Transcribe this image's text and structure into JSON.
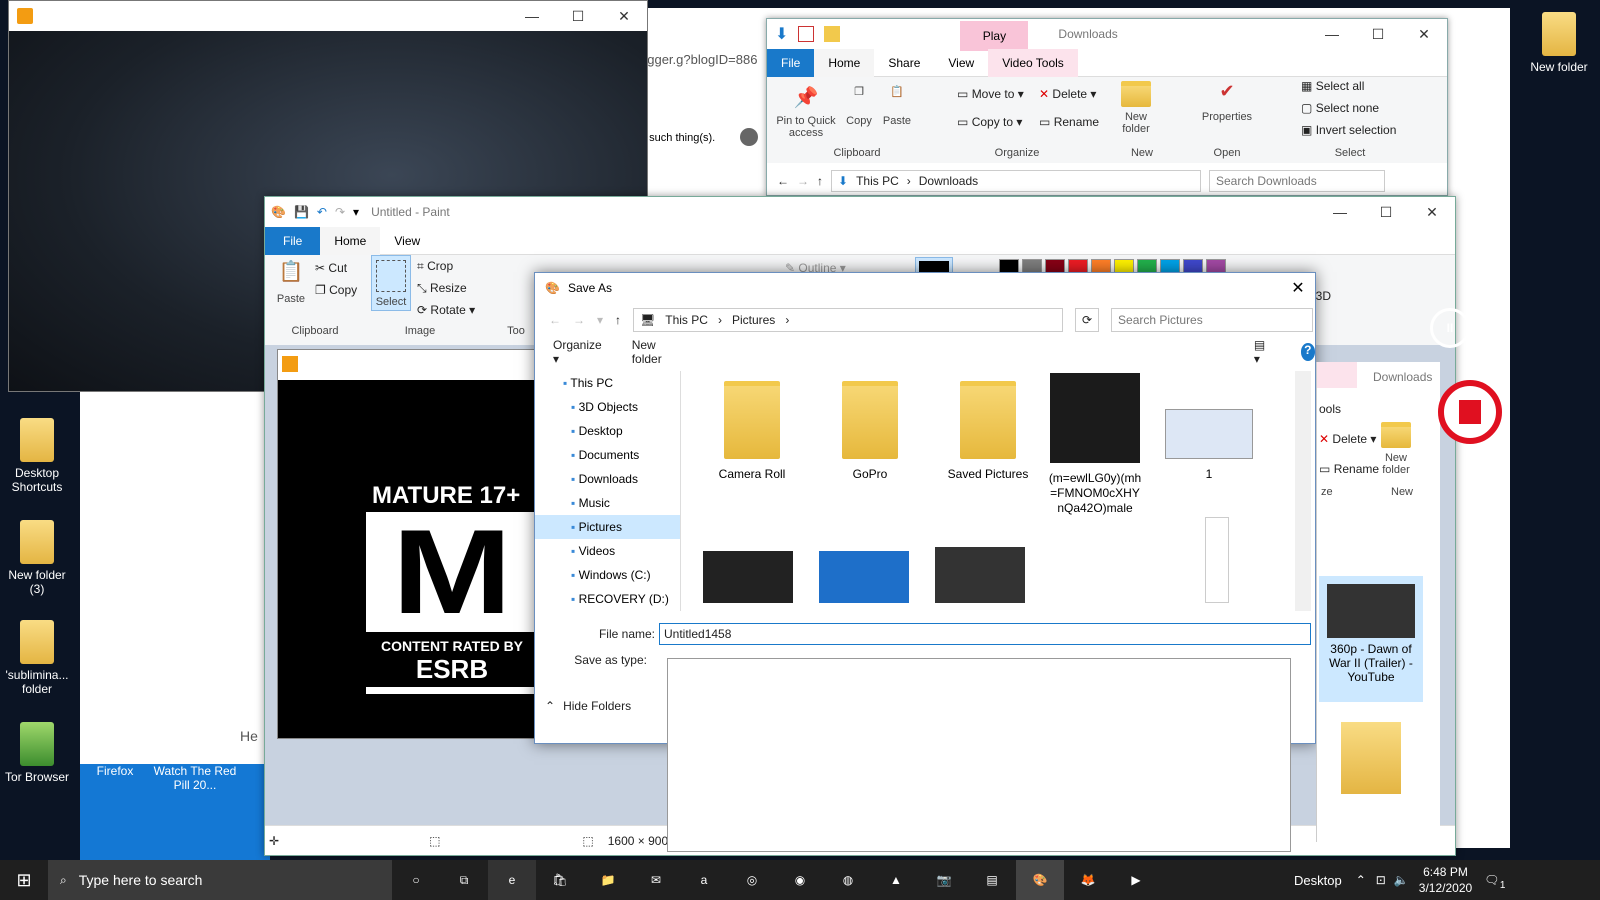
{
  "desktop": {
    "icons_left": [
      {
        "label": "Desktop Shortcuts",
        "name": "desktop-shortcuts-icon"
      },
      {
        "label": "New folder (3)",
        "name": "folder-icon"
      },
      {
        "label": "'sublimina... folder",
        "name": "folder-icon"
      },
      {
        "label": "Tor Browser",
        "name": "tor-browser-icon"
      }
    ],
    "icon_right": {
      "label": "New folder"
    },
    "icons_bottom": [
      {
        "label": "Firefox"
      },
      {
        "label": "Watch The Red Pill 20..."
      }
    ]
  },
  "browser": {
    "url_fragment": "ogger.g?blogID=886",
    "text1": "o such thing(s).",
    "text2": "He"
  },
  "downloads": {
    "title": "Downloads",
    "context_tab": "Play",
    "tabs": [
      "File",
      "Home",
      "Share",
      "View",
      "Video Tools"
    ],
    "clipboard": {
      "pin": "Pin to Quick access",
      "copy": "Copy",
      "paste": "Paste",
      "group": "Clipboard"
    },
    "organize": {
      "move": "Move to",
      "copy": "Copy to",
      "delete": "Delete",
      "rename": "Rename",
      "group": "Organize"
    },
    "new": {
      "folder": "New folder",
      "group": "New"
    },
    "open": {
      "properties": "Properties",
      "group": "Open"
    },
    "select": {
      "all": "Select all",
      "none": "Select none",
      "invert": "Invert selection",
      "group": "Select"
    },
    "path": [
      "This PC",
      "Downloads"
    ],
    "search_placeholder": "Search Downloads"
  },
  "paint": {
    "title": "Untitled - Paint",
    "tabs": [
      "File",
      "Home",
      "View"
    ],
    "clipboard": {
      "paste": "Paste",
      "cut": "Cut",
      "copy": "Copy",
      "group": "Clipboard"
    },
    "image": {
      "select": "Select",
      "crop": "Crop",
      "resize": "Resize",
      "rotate": "Rotate",
      "group": "Image"
    },
    "tools_group": "Too",
    "outline": "Outline",
    "edit3d": "with 3D",
    "size": "1600 × 900px",
    "colors": [
      "#000000",
      "#7f7f7f",
      "#880015",
      "#ed1c24",
      "#ff7f27",
      "#fff200",
      "#22b14c",
      "#00a2e8",
      "#3f48cc",
      "#a349a4"
    ]
  },
  "esrb": {
    "rating": "MATURE 17+",
    "letter": "M",
    "footer1": "CONTENT RATED BY",
    "footer2": "ESRB"
  },
  "save_as": {
    "title": "Save As",
    "path": [
      "This PC",
      "Pictures"
    ],
    "search_placeholder": "Search Pictures",
    "organize": "Organize",
    "new_folder": "New folder",
    "nav": [
      "This PC",
      "3D Objects",
      "Desktop",
      "Documents",
      "Downloads",
      "Music",
      "Pictures",
      "Videos",
      "Windows (C:)",
      "RECOVERY (D:)"
    ],
    "files": [
      "Camera Roll",
      "GoPro",
      "Saved Pictures",
      "(m=ewlLG0y)(mh=FMNOM0cXHYnQa42O)male",
      "1"
    ],
    "file_name_label": "File name:",
    "file_name_value": "Untitled1458",
    "save_as_type_label": "Save as type:",
    "hide_folders": "Hide Folders"
  },
  "downloads2": {
    "title": "Downloads",
    "tab": "ools",
    "delete": "Delete",
    "rename": "Rename",
    "new_folder": "New folder",
    "group": "New",
    "group2": "ze",
    "video": "360p - Dawn of War II (Trailer) - YouTube"
  },
  "taskbar": {
    "search_placeholder": "Type here to search",
    "desktop": "Desktop",
    "time": "6:48 PM",
    "date": "3/12/2020",
    "notif_count": "1"
  }
}
